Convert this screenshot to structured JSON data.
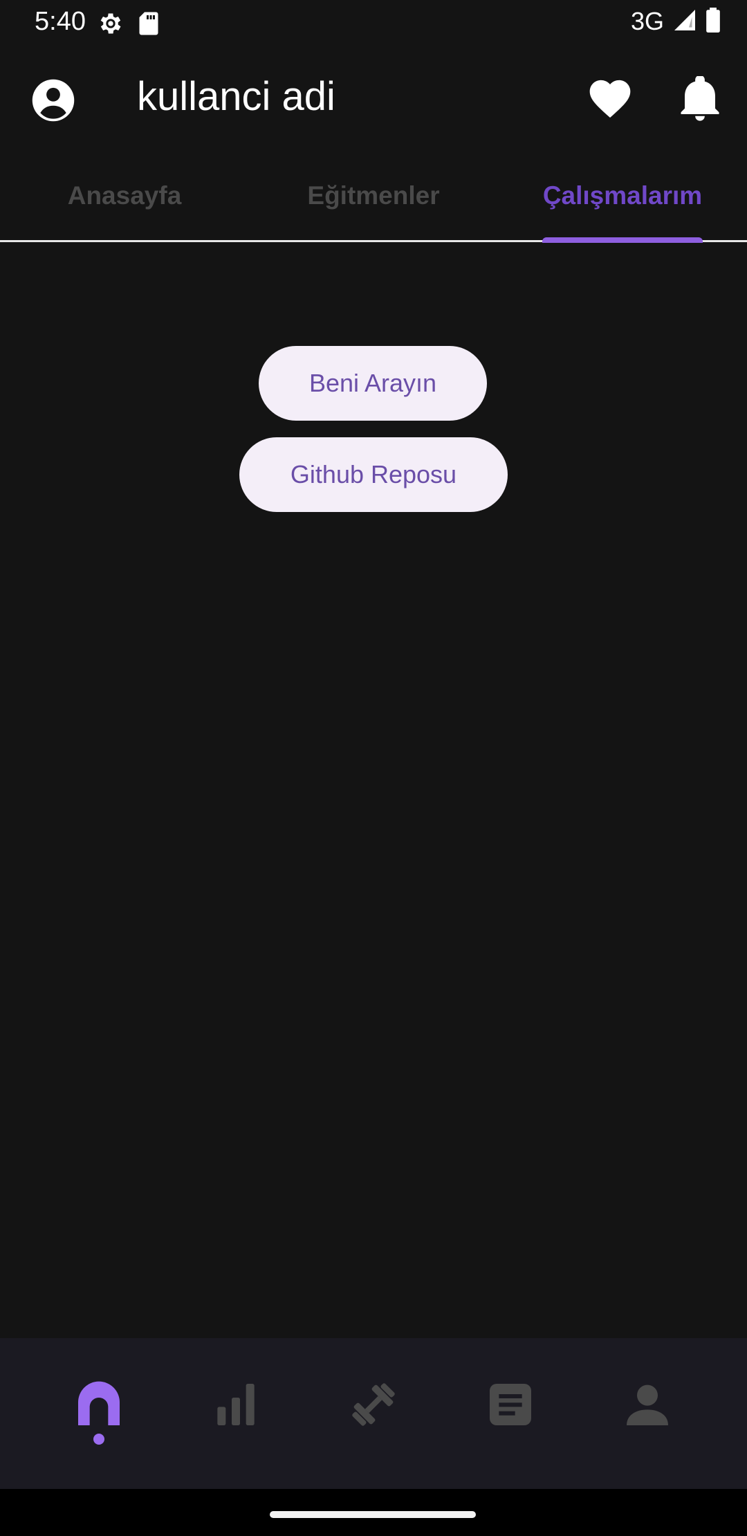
{
  "status_bar": {
    "time": "5:40",
    "network": "3G",
    "icons": [
      "settings-gear-icon",
      "sd-card-icon",
      "signal-icon",
      "battery-icon"
    ]
  },
  "app_bar": {
    "title": "kullanci adi",
    "icons": [
      "account-circle-icon",
      "heart-icon",
      "bell-icon"
    ]
  },
  "tabs": [
    {
      "label": "Anasayfa",
      "selected": false
    },
    {
      "label": "Eğitmenler",
      "selected": false
    },
    {
      "label": "Çalışmalarım",
      "selected": true
    }
  ],
  "main": {
    "call_button_label": "Beni Arayın",
    "github_button_label": "Github Reposu"
  },
  "bottom_nav": {
    "items": [
      {
        "icon": "home-icon",
        "active": true
      },
      {
        "icon": "bar-chart-icon",
        "active": false
      },
      {
        "icon": "fitness-dumbbell-icon",
        "active": false
      },
      {
        "icon": "document-icon",
        "active": false
      },
      {
        "icon": "person-icon",
        "active": false
      }
    ]
  },
  "colors": {
    "background": "#141414",
    "accent": "#7048c8",
    "indicator": "#8e5fe0",
    "button_bg": "#f4eef8",
    "button_text": "#6a4ea8",
    "nav_bg": "#1b1a22",
    "nav_inactive": "#4a4a4a"
  }
}
